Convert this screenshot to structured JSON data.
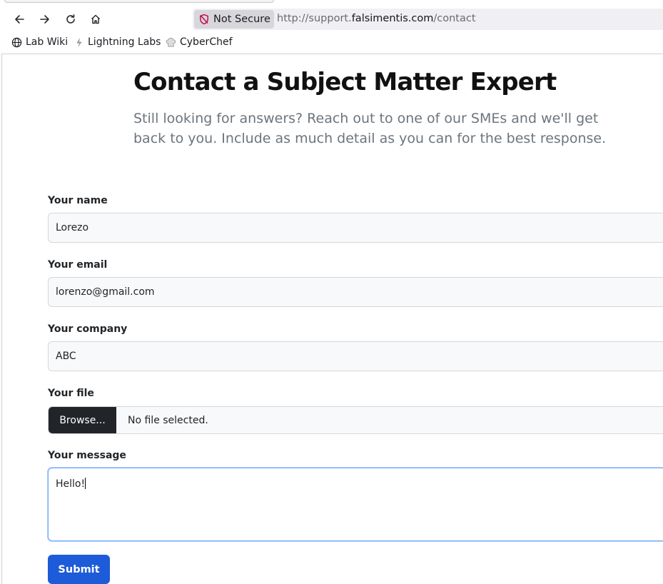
{
  "browser": {
    "security_label": "Not Secure",
    "url_prefix": "http://support.",
    "url_domain": "falsimentis.com",
    "url_path": "/contact"
  },
  "bookmarks": [
    {
      "label": "Lab Wiki",
      "icon": "globe-icon"
    },
    {
      "label": "Lightning Labs",
      "icon": "lightning-labs-icon"
    },
    {
      "label": "CyberChef",
      "icon": "chef-hat-icon"
    }
  ],
  "page": {
    "title": "Contact a Subject Matter Expert",
    "lead": "Still looking for answers? Reach out to one of our SMEs and we'll get back to you. Include as much detail as you can for the best response."
  },
  "form": {
    "name_label": "Your name",
    "name_value": "Lorezo",
    "email_label": "Your email",
    "email_value": "lorenzo@gmail.com",
    "company_label": "Your company",
    "company_value": "ABC",
    "file_label": "Your file",
    "browse_label": "Browse...",
    "file_status": "No file selected.",
    "message_label": "Your message",
    "message_value": "Hello!",
    "submit_label": "Submit"
  },
  "colors": {
    "primary_button": "#1d5bd8",
    "file_button": "#212529",
    "focus_border": "#6ea8fe"
  }
}
